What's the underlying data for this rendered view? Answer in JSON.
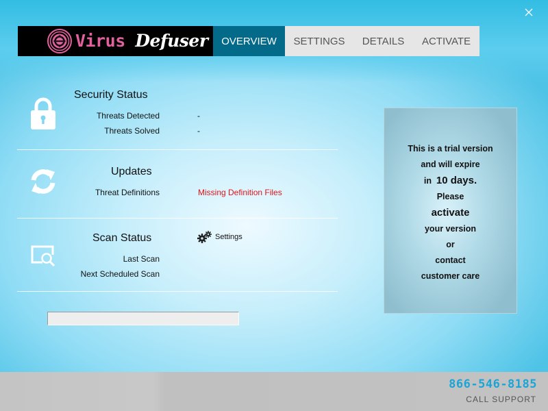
{
  "app": {
    "name_part1": "Virus",
    "name_part2": "Defuser",
    "close_icon": "close-icon"
  },
  "nav": {
    "tabs": [
      {
        "label": "OVERVIEW",
        "active": true
      },
      {
        "label": "SETTINGS",
        "active": false
      },
      {
        "label": "DETAILS",
        "active": false
      },
      {
        "label": "ACTIVATE",
        "active": false
      }
    ]
  },
  "security": {
    "icon": "lock-icon",
    "title": "Security Status",
    "rows": [
      {
        "label": "Threats Detected",
        "value": "-"
      },
      {
        "label": "Threats Solved",
        "value": "-"
      }
    ]
  },
  "updates": {
    "icon": "refresh-icon",
    "title": "Updates",
    "rows": [
      {
        "label": "Threat Definitions",
        "value": "Missing Definition Files"
      }
    ]
  },
  "scan": {
    "icon": "scan-icon",
    "title": "Scan Status",
    "settings_label": "Settings",
    "rows": [
      {
        "label": "Last Scan",
        "value": ""
      },
      {
        "label": "Next Scheduled Scan",
        "value": ""
      }
    ],
    "progress": 0
  },
  "trial": {
    "lines": [
      "This is a trial version",
      "and will expire",
      "in  ",
      "10 days.",
      "Please",
      "activate",
      "your version",
      "or",
      "contact",
      "customer care"
    ]
  },
  "footer": {
    "phone": "866-546-8185",
    "support_label": "CALL SUPPORT"
  },
  "colors": {
    "brand_pink": "#e2609e",
    "active_tab": "#036a8a",
    "alert_red": "#e0141b",
    "phone_blue": "#1ba5d6"
  }
}
